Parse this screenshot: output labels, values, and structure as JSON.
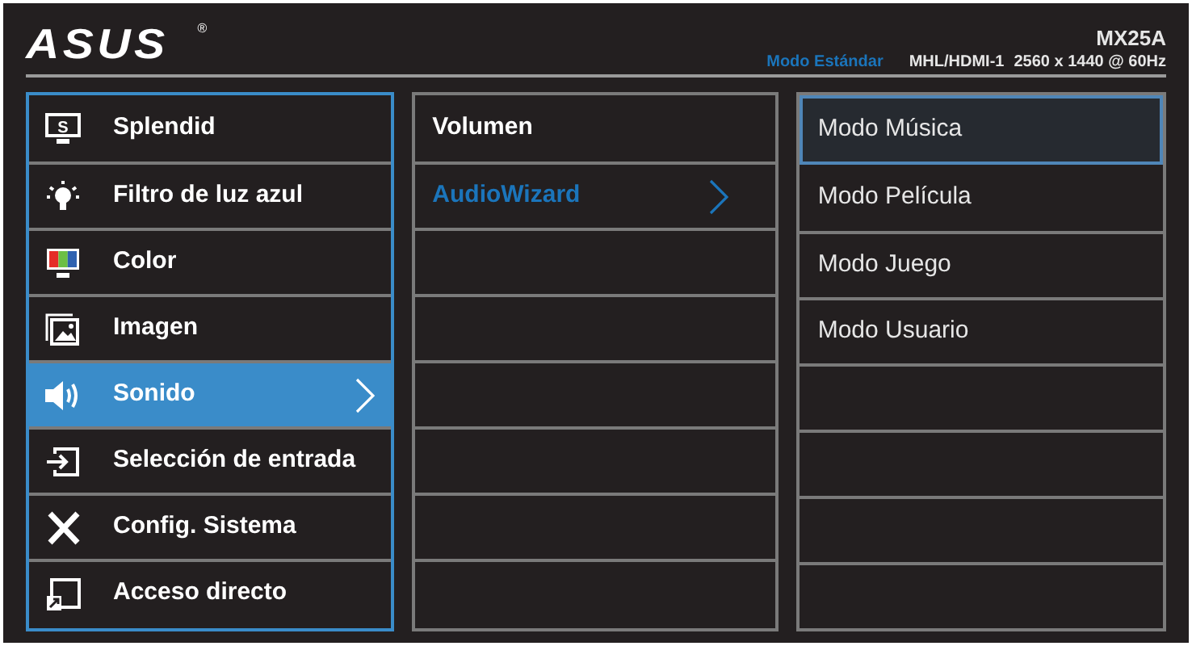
{
  "header": {
    "logo": "ASUS",
    "registered": "®",
    "model": "MX25A",
    "mode": "Modo Estándar",
    "input": "MHL/HDMI-1",
    "resolution": "2560 x 1440 @ 60Hz"
  },
  "main_menu": [
    {
      "label": "Splendid",
      "kind": "splendid",
      "icon_letter": "S",
      "selected": false
    },
    {
      "label": "Filtro de luz azul",
      "kind": "bulb",
      "selected": false
    },
    {
      "label": "Color",
      "kind": "color",
      "selected": false
    },
    {
      "label": "Imagen",
      "kind": "image",
      "selected": false
    },
    {
      "label": "Sonido",
      "kind": "speaker",
      "selected": true
    },
    {
      "label": "Selección de entrada",
      "kind": "input",
      "selected": false
    },
    {
      "label": "Config. Sistema",
      "kind": "tools",
      "selected": false
    },
    {
      "label": "Acceso directo",
      "kind": "shortcut",
      "selected": false
    }
  ],
  "submenu": [
    {
      "label": "Volumen",
      "selected": false
    },
    {
      "label": "AudioWizard",
      "selected": true
    }
  ],
  "options": [
    {
      "label": "Modo Música",
      "selected": true
    },
    {
      "label": "Modo Película",
      "selected": false
    },
    {
      "label": "Modo Juego",
      "selected": false
    },
    {
      "label": "Modo Usuario",
      "selected": false
    }
  ]
}
